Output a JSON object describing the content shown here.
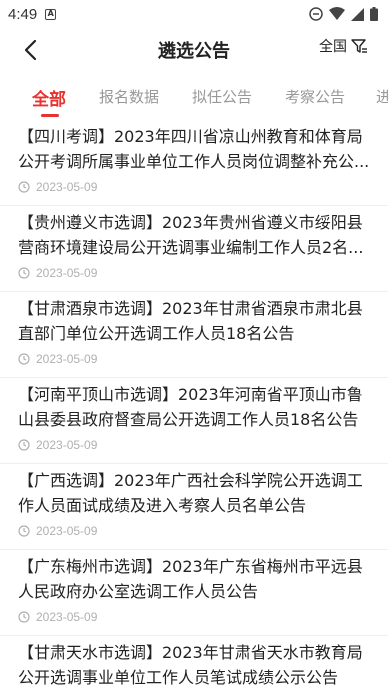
{
  "status_bar": {
    "time": "4:49",
    "notification_icon": "a-icon"
  },
  "nav": {
    "title": "遴选公告",
    "filter_label": "全国",
    "back_icon": "chevron-left-icon",
    "filter_icon": "filter-funnel-icon"
  },
  "tabs": [
    {
      "label": "全部",
      "active": true
    },
    {
      "label": "报名数据",
      "active": false
    },
    {
      "label": "拟任公告",
      "active": false
    },
    {
      "label": "考察公告",
      "active": false
    },
    {
      "label": "进",
      "active": false
    }
  ],
  "colors": {
    "accent": "#e8322f",
    "muted": "#999999",
    "date": "#b0b0b0"
  },
  "articles": [
    {
      "title": "【四川考调】2023年四川省凉山州教育和体育局公开考调所属事业单位工作人员岗位调整补充公...",
      "date": "2023-05-09"
    },
    {
      "title": "【贵州遵义市选调】2023年贵州省遵义市绥阳县营商环境建设局公开选调事业编制工作人员2名...",
      "date": "2023-05-09"
    },
    {
      "title": "【甘肃酒泉市选调】2023年甘肃省酒泉市肃北县直部门单位公开选调工作人员18名公告",
      "date": "2023-05-09"
    },
    {
      "title": "【河南平顶山市选调】2023年河南省平顶山市鲁山县委县政府督查局公开选调工作人员18名公告",
      "date": "2023-05-09"
    },
    {
      "title": "【广西选调】2023年广西社会科学院公开选调工作人员面试成绩及进入考察人员名单公告",
      "date": "2023-05-09"
    },
    {
      "title": "【广东梅州市选调】2023年广东省梅州市平远县人民政府办公室选调工作人员公告",
      "date": "2023-05-09"
    },
    {
      "title": "【甘肃天水市选调】2023年甘肃省天水市教育局公开选调事业单位工作人员笔试成绩公示公告",
      "date": ""
    }
  ]
}
